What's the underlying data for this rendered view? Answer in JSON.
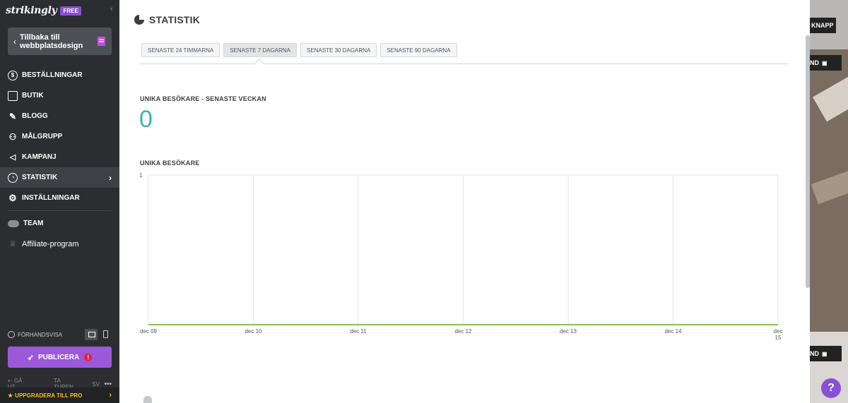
{
  "sidebar": {
    "logo": "strikingly",
    "plan_badge": "FREE",
    "back_button": "Tillbaka till webbplatsdesign",
    "nav": [
      {
        "label": "BESTÄLLNINGAR",
        "icon": "dollar-icon"
      },
      {
        "label": "BUTIK",
        "icon": "store-icon"
      },
      {
        "label": "BLOGG",
        "icon": "pen-icon"
      },
      {
        "label": "MÅLGRUPP",
        "icon": "audience-icon"
      },
      {
        "label": "KAMPANJ",
        "icon": "megaphone-icon"
      },
      {
        "label": "STATISTIK",
        "icon": "pie-chart-icon",
        "active": true
      },
      {
        "label": "INSTÄLLNINGAR",
        "icon": "gear-icon"
      }
    ],
    "nav_secondary": [
      {
        "label": "TEAM",
        "icon": "team-icon"
      },
      {
        "label": "Affiliate-program",
        "icon": "trophy-icon"
      }
    ],
    "preview_label": "FÖRHANDSVISA",
    "publish_button": "PUBLICERA",
    "footer": {
      "logout": "GÅ UT",
      "tour": "TA TUREN",
      "lang": "SV",
      "more": "•••"
    },
    "upgrade": "UPPGRADERA TILL PRO"
  },
  "main": {
    "title": "STATISTIK",
    "tabs": [
      {
        "label": "SENASTE 24 TIMMARNA",
        "active": false
      },
      {
        "label": "SENASTE 7 DAGARNA",
        "active": true
      },
      {
        "label": "SENASTE 30 DAGARNA",
        "active": false
      },
      {
        "label": "SENASTE 90 DAGARNA",
        "active": false
      }
    ],
    "unique_week_label": "UNIKA BESÖKARE - SENASTE VECKAN",
    "unique_week_value": "0",
    "chart_label": "UNIKA BESÖKARE"
  },
  "chart_data": {
    "type": "line",
    "x": [
      "dec 09",
      "dec 10",
      "dec 11",
      "dec 12",
      "dec 13",
      "dec 14",
      "dec 15"
    ],
    "series": [
      {
        "values": [
          0,
          0,
          0,
          0,
          0,
          0,
          0
        ]
      }
    ],
    "ylim": [
      0,
      1
    ],
    "yticks": [
      "1"
    ],
    "grid": true,
    "line_color": "#8bc34a"
  },
  "right_peek": {
    "button_top": "KNAPP",
    "button_mid": "ND",
    "button_bot": "ND",
    "help": "?"
  },
  "colors": {
    "accent": "#9b59d9",
    "teal": "#3fb3a8",
    "upgrade": "#f7c21b"
  }
}
